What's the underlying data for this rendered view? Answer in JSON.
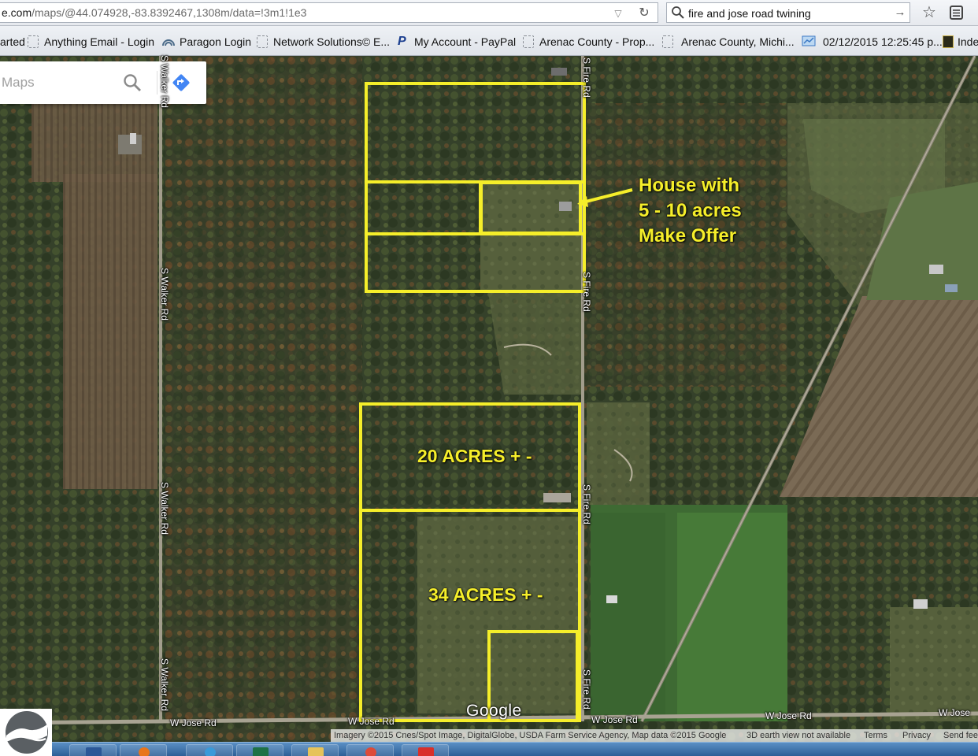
{
  "browser": {
    "url_host": "e.com",
    "url_rest": "/maps/@44.074928,-83.8392467,1308m/data=!3m1!1e3",
    "search_query": "fire and jose road twining"
  },
  "bookmarks": [
    {
      "label": "arted",
      "icon": "none"
    },
    {
      "label": "Anything Email - Login",
      "icon": "page-icon"
    },
    {
      "label": "Paragon Login",
      "icon": "paragon-icon"
    },
    {
      "label": "Network Solutions© E...",
      "icon": "page-icon"
    },
    {
      "label": "My Account - PayPal",
      "icon": "paypal-icon"
    },
    {
      "label": "Arenac County - Prop...",
      "icon": "page-icon"
    },
    {
      "label": "Arenac County, Michi...",
      "icon": "page-icon"
    },
    {
      "label": "02/12/2015 12:25:45 p...",
      "icon": "report-icon"
    },
    {
      "label": "Inde",
      "icon": "index-icon"
    }
  ],
  "maps_card": {
    "placeholder": "Maps"
  },
  "roads": {
    "walker_1": "S Walker Rd",
    "walker_2": "S Walker Rd",
    "walker_3": "S Walker Rd",
    "walker_4": "S Walker Rd",
    "fire_1": "S Fire Rd",
    "fire_2": "S Fire Rd",
    "fire_3": "S Fire Rd",
    "fire_4": "S Fire Rd",
    "jose_1": "W Jose Rd",
    "jose_2": "W Jose Rd",
    "jose_3": "W Jose Rd",
    "jose_4": "W Jose Rd",
    "jose_5": "W Jose"
  },
  "annotations": {
    "house_line1": "House with",
    "house_line2": "5 - 10 acres",
    "house_line3": "Make Offer",
    "parcel_20": "20 ACRES + -",
    "parcel_34": "34 ACRES + -",
    "outline_color": "#f5ee2a"
  },
  "google_logo": "Google",
  "attribution": {
    "imagery": "Imagery ©2015 Cnes/Spot Image, DigitalGlobe, USDA Farm Service Agency, Map data ©2015 Google",
    "earth_view": "3D earth view not available",
    "terms": "Terms",
    "privacy": "Privacy",
    "feedback": "Send fee"
  }
}
